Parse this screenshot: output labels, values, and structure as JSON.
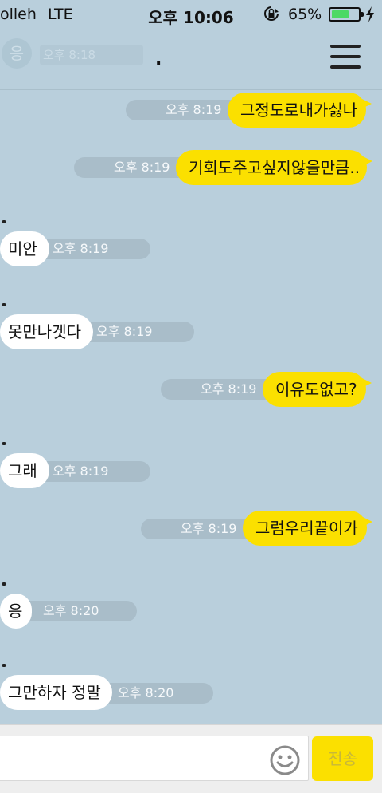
{
  "status_bar": {
    "carrier": "olleh",
    "network": "LTE",
    "time": "오후 10:06",
    "battery_percent": "65%",
    "battery_level": 0.65,
    "battery_color": "#4cd964"
  },
  "header": {
    "title": ".",
    "ghost_avatar_text": "응",
    "ghost_preview_text": "오후 8:18",
    "menu_icon": "hamburger-menu-icon"
  },
  "messages": [
    {
      "sender": "me",
      "text": "그정도로내가싫나",
      "time": "오후 8:19"
    },
    {
      "sender": "me",
      "text": "기회도주고싶지않을만큼..",
      "time": "오후 8:19"
    },
    {
      "sender": "them",
      "name": ".",
      "text": "미안",
      "time": "오후 8:19"
    },
    {
      "sender": "them",
      "name": ".",
      "text": "못만나겟다",
      "time": "오후 8:19"
    },
    {
      "sender": "me",
      "text": "이유도없고?",
      "time": "오후 8:19"
    },
    {
      "sender": "them",
      "name": ".",
      "text": "그래",
      "time": "오후 8:19"
    },
    {
      "sender": "me",
      "text": "그럼우리끝이가",
      "time": "오후 8:19"
    },
    {
      "sender": "them",
      "name": ".",
      "text": "응",
      "time": "오후 8:20"
    },
    {
      "sender": "them",
      "name": ".",
      "text": "그만하자 정말",
      "time": "오후 8:20"
    }
  ],
  "input_bar": {
    "placeholder": "",
    "send_label": "전송",
    "emoji_icon": "smiley-emoticon-icon"
  },
  "colors": {
    "chat_background": "#b9cfdc",
    "my_bubble": "#fbe000",
    "their_bubble": "#ffffff",
    "time_pill": "#a9bdc9"
  }
}
